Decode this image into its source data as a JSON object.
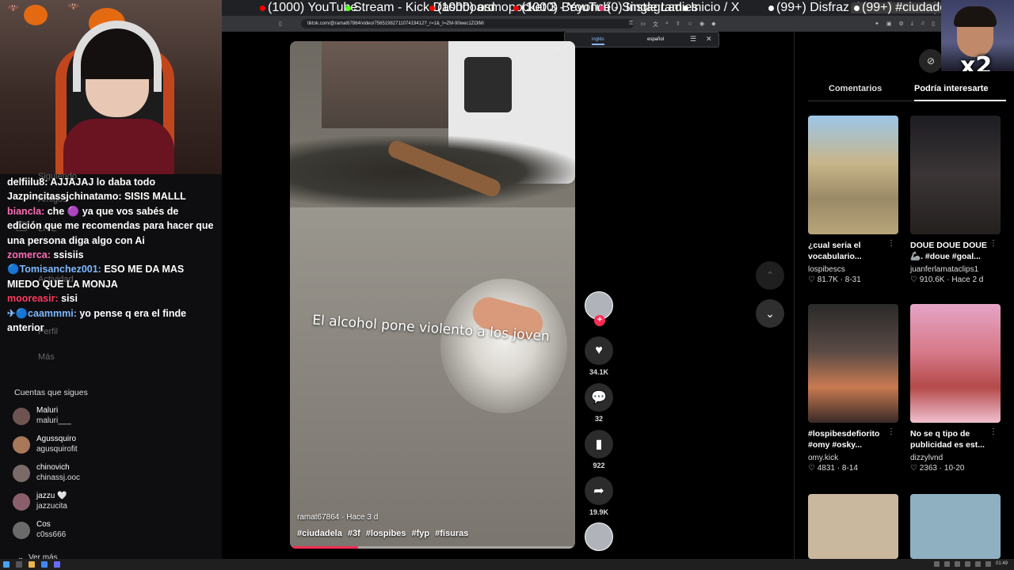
{
  "browser": {
    "tabs": [
      {
        "label": "(1000) YouTube",
        "color": "#ff0000"
      },
      {
        "label": "Stream - Kick Dashboard",
        "color": "#53fc18"
      },
      {
        "label": "(1000) osmopocket 3 - YouTub",
        "color": "#ff0000"
      },
      {
        "label": "(1000) Beyoncé - Single Ladies",
        "color": "#ff0000"
      },
      {
        "label": "(0) Instagram",
        "color": "#e1306c"
      },
      {
        "label": "Inicio / X",
        "color": "#ffffff"
      },
      {
        "label": "(99+) Disfraz de Halloween | Lo",
        "color": "#ffffff"
      },
      {
        "label": "(99+) #ciudadela #3f #",
        "color": "#ffffff"
      }
    ],
    "url": "tiktok.com/@ramat67864/video/7565198271107419412?_r=1&_t=ZM-90wec1ZOlMi",
    "translate": {
      "from": "inglés",
      "to": "español"
    }
  },
  "chat": {
    "messages": [
      {
        "user": "delfiilu8:",
        "user_color": "#ffffff",
        "text": " AJJAJAJ lo daba todo"
      },
      {
        "user": "Jazpincitassjchinatamo:",
        "user_color": "#ffffff",
        "text": " SISIS MALLL"
      },
      {
        "user": "biancla:",
        "user_color": "#ff6bb5",
        "text": " che 🟣 ya que vos sabés de edición que me recomendas para hacer que una persona diga algo con Ai"
      },
      {
        "user": "zomerca:",
        "user_color": "#ff6bb5",
        "text": " ssisiis"
      },
      {
        "user": "🔵Tomisanchez001:",
        "user_color": "#7fb8ff",
        "text": " ESO ME DA MAS MIEDO QUE LA MONJA"
      },
      {
        "user": "mooreasir:",
        "user_color": "#ff3a5c",
        "text": " sisi"
      },
      {
        "user": "✈🔵caammmi:",
        "user_color": "#7fb8ff",
        "text": " yo pense q era el finde anterior"
      }
    ],
    "ghost": {
      "siguiendo": "Siguiendo",
      "amigos": "Amigos",
      "live": "LIVE",
      "actividad": "Actividad",
      "perfil": "Perfil",
      "mas": "Más"
    }
  },
  "follows": {
    "title": "Cuentas que sigues",
    "accounts": [
      {
        "name": "Maluri",
        "handle": "maluri___"
      },
      {
        "name": "Agussquiro",
        "handle": "agusquirofit"
      },
      {
        "name": "chinovich",
        "handle": "chinassj.ooc"
      },
      {
        "name": "jazzu 🤍",
        "handle": "jazzucita"
      },
      {
        "name": "Cos",
        "handle": "c0ss666"
      }
    ],
    "more": "Ver más"
  },
  "video": {
    "caption": "El alcohol pone violento a los joven",
    "author_line": "ramat67864 · Hace 3 d",
    "tags": [
      "#ciudadela",
      "#3f",
      "#lospibes",
      "#fyp",
      "#fisuras"
    ],
    "progress": 0.24,
    "progress_color": "#fe2c55"
  },
  "actions": {
    "likes": "34.1K",
    "comments": "32",
    "saves": "922",
    "shares": "19.9K"
  },
  "overlay": {
    "multiplier": "x2"
  },
  "right": {
    "tab_comments": "Comentarios",
    "tab_suggested": "Podría interesarte",
    "cards": [
      {
        "title": "¿cual seria el vocabulario...",
        "author": "lospibescs",
        "likes": "81.7K",
        "date": "8-31"
      },
      {
        "title": "DOUE DOUE DOUE 🦾. #doue #goal...",
        "author": "juanferlamataclips1",
        "likes": "910.6K",
        "date": "Hace 2 d"
      },
      {
        "title": "#lospibesdefiorito #omy #osky...",
        "author": "omy.kick",
        "likes": "4831",
        "date": "8-14"
      },
      {
        "title": "No se q tipo de publicidad es est...",
        "author": "dizzylvnd",
        "likes": "2363",
        "date": "10-20"
      }
    ]
  },
  "taskbar": {
    "clock": "01:49"
  }
}
